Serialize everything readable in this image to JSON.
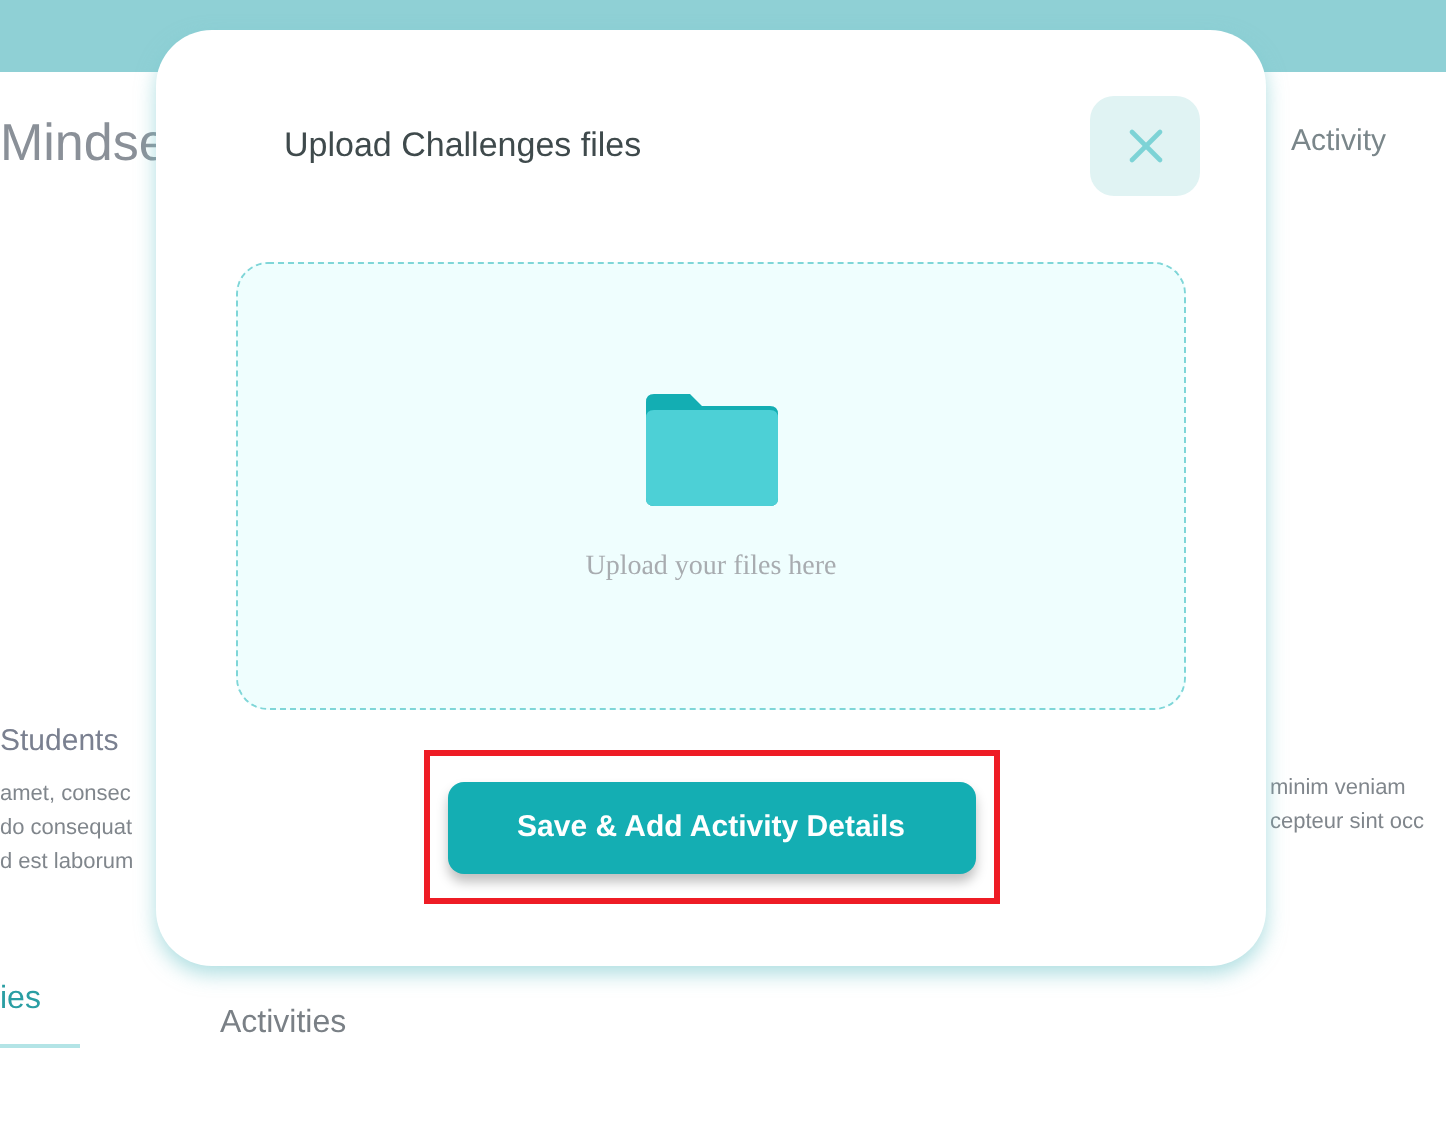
{
  "background": {
    "heading": "Mindse",
    "right_tab": "Activity",
    "section_title": "Students",
    "left_lines": [
      "amet, consec",
      "do consequat",
      "d est laborum"
    ],
    "right_lines": [
      "minim veniam",
      "cepteur sint occ"
    ],
    "tabs": [
      {
        "label": "ies",
        "selected": true
      },
      {
        "label": "Activities",
        "selected": false
      }
    ]
  },
  "modal": {
    "title": "Upload Challenges files",
    "dropzone": {
      "hint": "Upload your files here"
    },
    "primary_button": "Save & Add Activity Details",
    "highlighted": true
  }
}
